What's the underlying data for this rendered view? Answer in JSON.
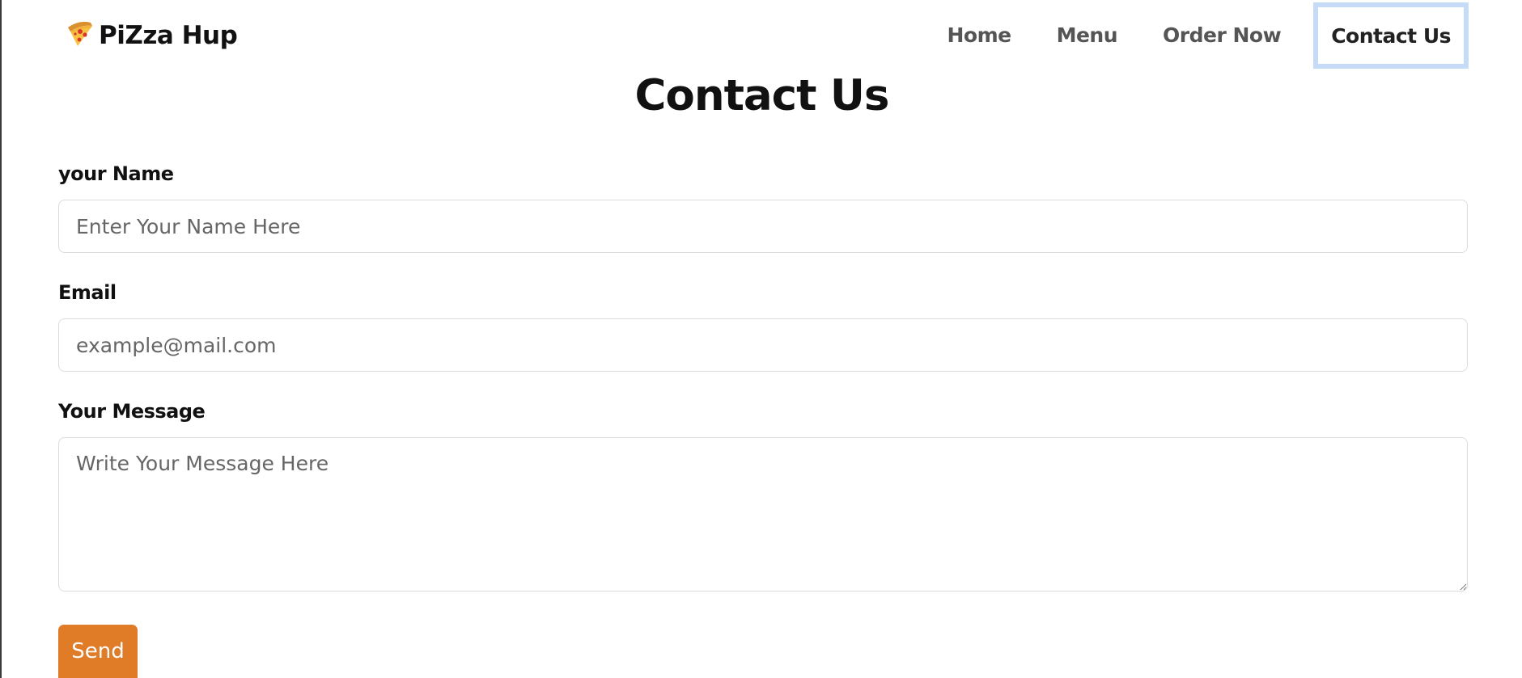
{
  "brand": {
    "name": "PiZza Hup",
    "icon": "pizza-slice-icon"
  },
  "nav": {
    "items": [
      {
        "label": "Home"
      },
      {
        "label": "Menu"
      },
      {
        "label": "Order Now"
      },
      {
        "label": "Contact Us",
        "active": true
      }
    ]
  },
  "page": {
    "title": "Contact Us"
  },
  "form": {
    "name": {
      "label": "your Name",
      "placeholder": "Enter Your Name Here",
      "value": ""
    },
    "email": {
      "label": "Email",
      "placeholder": "example@mail.com",
      "value": ""
    },
    "message": {
      "label": "Your Message",
      "placeholder": "Write Your Message Here",
      "value": ""
    },
    "submit_label": "Send"
  },
  "colors": {
    "accent": "#e07b27",
    "active_nav_border": "#c6dbf7",
    "nav_text": "#555555"
  }
}
